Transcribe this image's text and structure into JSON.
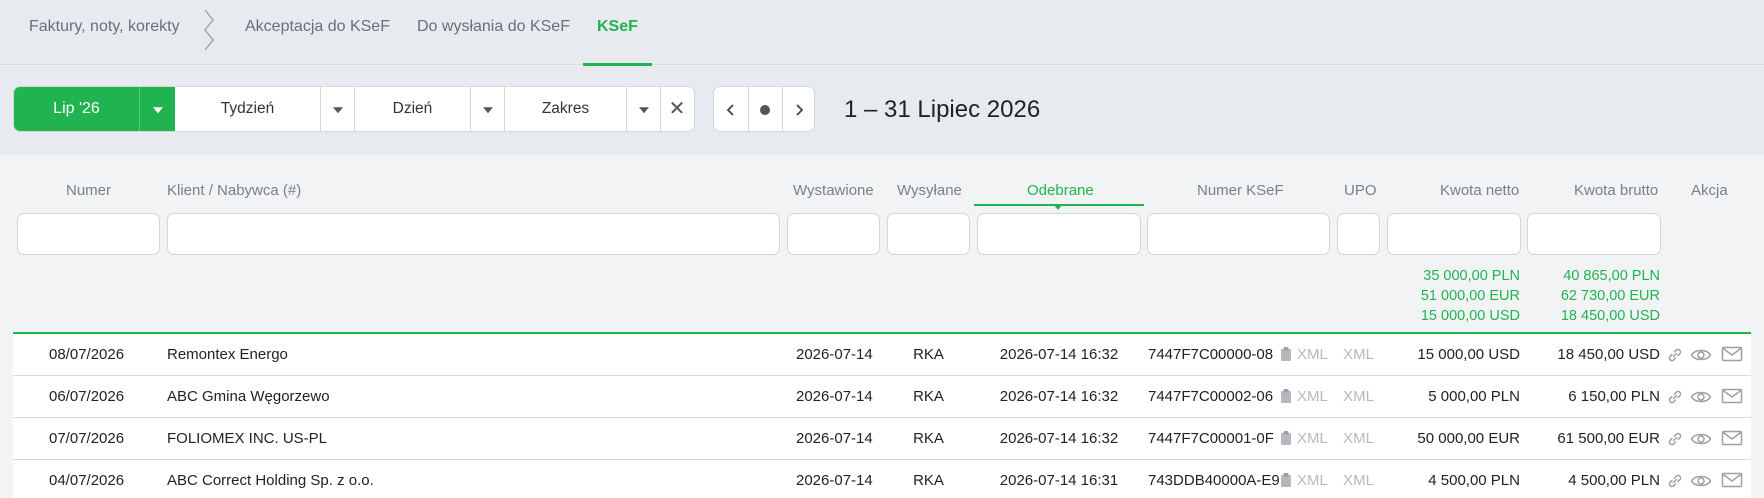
{
  "tabs": [
    {
      "label": "Faktury, noty, korekty"
    },
    {
      "label": "Akceptacja do KSeF"
    },
    {
      "label": "Do wysłania do KSeF"
    },
    {
      "label": "KSeF"
    }
  ],
  "toolbar": {
    "month_label": "Lip '26",
    "week_label": "Tydzień",
    "day_label": "Dzień",
    "range_label": "Zakres",
    "period_title": "1 – 31 Lipiec 2026"
  },
  "columns": {
    "numer": "Numer",
    "klient": "Klient / Nabywca (#)",
    "wystawione": "Wystawione",
    "wysylane": "Wysyłane",
    "odebrane": "Odebrane",
    "numer_ksef": "Numer KSeF",
    "upo": "UPO",
    "kwota_netto": "Kwota netto",
    "kwota_brutto": "Kwota brutto",
    "akcja": "Akcja"
  },
  "totals": {
    "netto": [
      "35 000,00 PLN",
      "51 000,00 EUR",
      "15 000,00 USD"
    ],
    "brutto": [
      "40 865,00 PLN",
      "62 730,00 EUR",
      "18 450,00 USD"
    ]
  },
  "rows": [
    {
      "numer": "08/07/2026",
      "klient": "Remontex Energo",
      "wystawione": "2026-07-14",
      "wysylane": "RKA",
      "odebrane": "2026-07-14 16:32",
      "ksef": "7447F7C00000-08",
      "xml": "XML",
      "upo": "XML",
      "netto": "15 000,00 USD",
      "brutto": "18 450,00 USD"
    },
    {
      "numer": "06/07/2026",
      "klient": "ABC Gmina Węgorzewo",
      "wystawione": "2026-07-14",
      "wysylane": "RKA",
      "odebrane": "2026-07-14 16:32",
      "ksef": "7447F7C00002-06",
      "xml": "XML",
      "upo": "XML",
      "netto": "5 000,00 PLN",
      "brutto": "6 150,00 PLN"
    },
    {
      "numer": "07/07/2026",
      "klient": "FOLIOMEX INC. US-PL",
      "wystawione": "2026-07-14",
      "wysylane": "RKA",
      "odebrane": "2026-07-14 16:32",
      "ksef": "7447F7C00001-0F",
      "xml": "XML",
      "upo": "XML",
      "netto": "50 000,00 EUR",
      "brutto": "61 500,00 EUR"
    },
    {
      "numer": "04/07/2026",
      "klient": "ABC Correct Holding Sp. z o.o.",
      "wystawione": "2026-07-14",
      "wysylane": "RKA",
      "odebrane": "2026-07-14 16:31",
      "ksef": "743DDB40000A-E9",
      "xml": "XML",
      "upo": "XML",
      "netto": "4 500,00 PLN",
      "brutto": "4 500,00 PLN"
    }
  ],
  "colors": {
    "accent": "#21b350",
    "muted": "#b5b9bf"
  }
}
